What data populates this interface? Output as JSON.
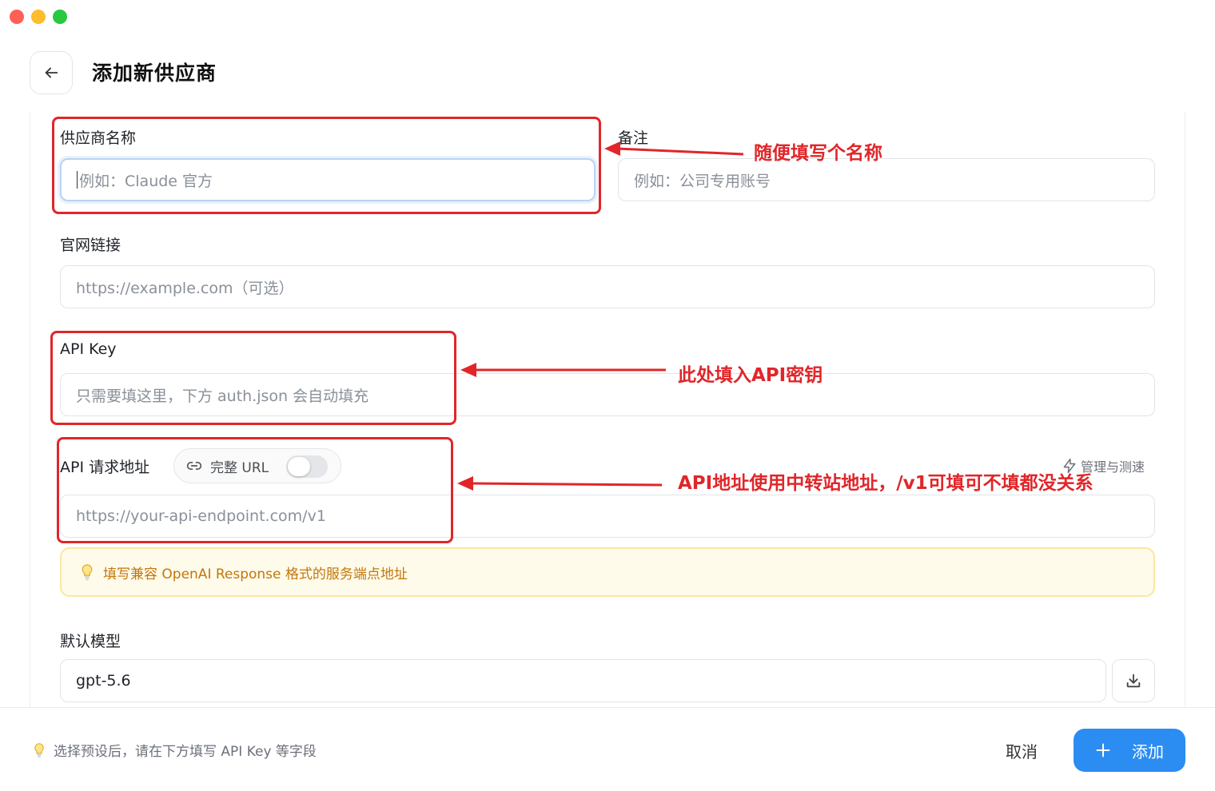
{
  "header": {
    "title": "添加新供应商"
  },
  "form": {
    "provider_name": {
      "label": "供应商名称",
      "placeholder": "例如：Claude 官方"
    },
    "notes": {
      "label": "备注",
      "placeholder": "例如：公司专用账号"
    },
    "website": {
      "label": "官网链接",
      "placeholder": "https://example.com（可选）"
    },
    "api_key": {
      "label": "API Key",
      "placeholder": "只需要填这里，下方 auth.json 会自动填充"
    },
    "api_url": {
      "label": "API 请求地址",
      "toggle_label": "完整 URL",
      "toggle_on": false,
      "manage_label": "管理与测速",
      "placeholder": "https://your-api-endpoint.com/v1"
    },
    "hint": "填写兼容 OpenAI Response 格式的服务端点地址",
    "default_model": {
      "label": "默认模型",
      "value": "gpt-5.6"
    }
  },
  "footer": {
    "hint": "选择预设后，请在下方填写 API Key 等字段",
    "cancel_label": "取消",
    "add_label": "添加"
  },
  "annotations": {
    "name_note": "随便填写个名称",
    "key_note": "此处填入API密钥",
    "url_note": "API地址使用中转站地址，/v1可填可不填都没关系"
  },
  "colors": {
    "accent": "#2b8cf2",
    "annotation_red": "#e0262a",
    "hint_text": "#c2760c",
    "hint_bg": "#fffbea"
  }
}
